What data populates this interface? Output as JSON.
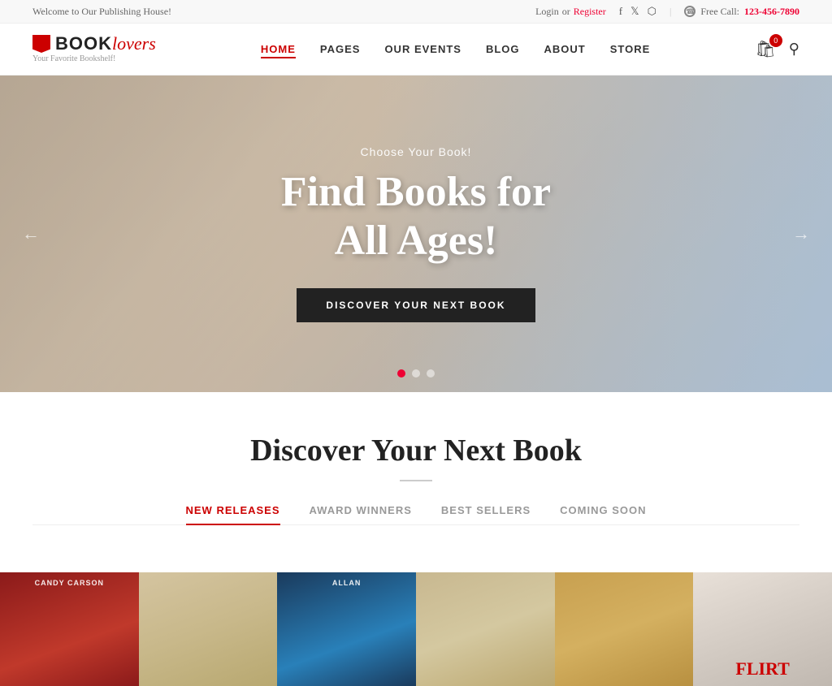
{
  "topbar": {
    "welcome": "Welcome to Our Publishing House!",
    "login": "Login",
    "or": "or",
    "register": "Register",
    "free_call": "Free Call:",
    "phone": "123-456-7890",
    "social": [
      "f",
      "𝕏",
      "📷"
    ]
  },
  "header": {
    "logo_book": "BOOK",
    "logo_lovers": "lovers",
    "logo_sub": "Your Favorite Bookshelf!",
    "nav": [
      {
        "label": "HOME",
        "active": true
      },
      {
        "label": "PAGES",
        "active": false
      },
      {
        "label": "OUR EVENTS",
        "active": false
      },
      {
        "label": "BLOG",
        "active": false
      },
      {
        "label": "ABOUT",
        "active": false
      },
      {
        "label": "STORE",
        "active": false
      }
    ],
    "cart_count": "0"
  },
  "hero": {
    "subtitle": "Choose Your Book!",
    "title": "Find Books for\nAll Ages!",
    "cta": "DISCOVER YOUR NEXT BOOK",
    "arrow_left": "←",
    "arrow_right": "→",
    "dots": [
      true,
      false,
      false
    ]
  },
  "discover": {
    "title": "Discover Your Next Book",
    "tabs": [
      {
        "label": "NEW RELEASES",
        "active": true
      },
      {
        "label": "AWARD WINNERS",
        "active": false
      },
      {
        "label": "BEST SELLERS",
        "active": false
      },
      {
        "label": "COMING SOON",
        "active": false
      }
    ]
  },
  "books": [
    {
      "author": "CANDY CARSON",
      "title": "",
      "color": "book-1"
    },
    {
      "author": "",
      "title": "",
      "color": "book-2"
    },
    {
      "author": "ALLAN",
      "title": "",
      "color": "book-3"
    },
    {
      "author": "",
      "title": "",
      "color": "book-4"
    },
    {
      "author": "",
      "title": "",
      "color": "book-5"
    },
    {
      "author": "FLIRT",
      "title": "",
      "color": "book-6"
    }
  ]
}
